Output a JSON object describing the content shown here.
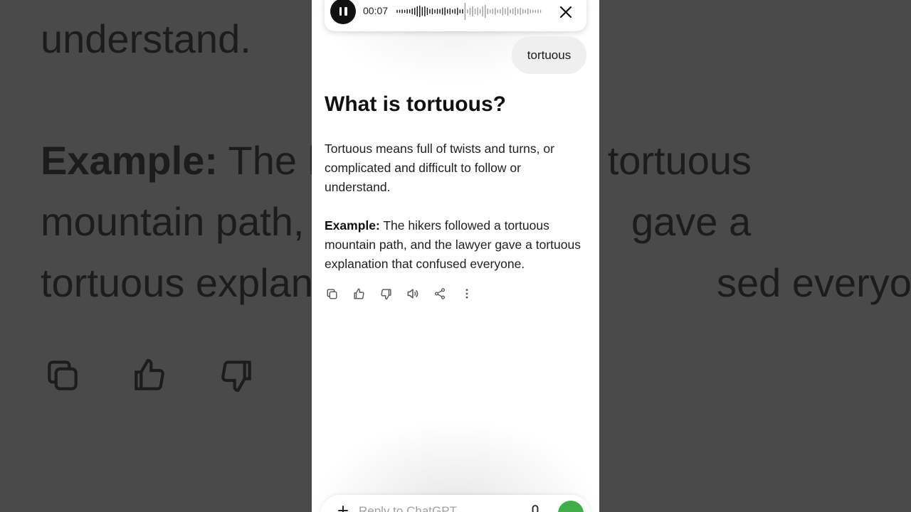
{
  "background": {
    "line1": "understand.",
    "line2_bold": "Example:",
    "line2_rest": " The h",
    "line2_right": "a tortuous",
    "line3": "mountain path,",
    "line3_right": "gave a",
    "line4": "tortuous explan",
    "line4_right": "sed everyone."
  },
  "recording": {
    "time": "00:07",
    "pause_icon": "pause-icon",
    "close_icon": "close-icon"
  },
  "user_message": "tortuous",
  "answer": {
    "title": "What is tortuous?",
    "definition": "Tortuous means full of twists and turns, or complicated and difficult to follow or understand.",
    "example_label": "Example:",
    "example_text": " The hikers followed a tortuous mountain path, and the lawyer gave a tortuous explanation that confused everyone."
  },
  "actions": [
    "copy-icon",
    "thumbs-up-icon",
    "thumbs-down-icon",
    "read-aloud-icon",
    "share-icon",
    "more-icon"
  ],
  "composer": {
    "placeholder": "Reply to ChatGPT",
    "accent": "#3fae48"
  }
}
